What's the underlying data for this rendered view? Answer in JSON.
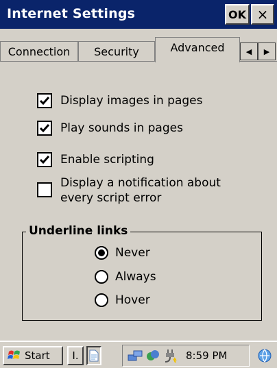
{
  "window": {
    "title": "Internet Settings",
    "ok_label": "OK",
    "close_label": "×"
  },
  "tabs": [
    {
      "label": "Connection"
    },
    {
      "label": "Security"
    },
    {
      "label": "Advanced",
      "selected": true
    }
  ],
  "tab_scroll": {
    "prev_glyph": "◀",
    "next_glyph": "▶"
  },
  "options": [
    {
      "label": "Display images in pages",
      "checked": true
    },
    {
      "label": "Play sounds in pages",
      "checked": true
    },
    {
      "label": "Enable scripting",
      "checked": true
    },
    {
      "label": "Display a notification about every script error",
      "checked": false
    }
  ],
  "underline_links": {
    "title": "Underline links",
    "options": [
      {
        "label": "Never",
        "selected": true
      },
      {
        "label": "Always",
        "selected": false
      },
      {
        "label": "Hover",
        "selected": false
      }
    ]
  },
  "taskbar": {
    "start_label": "Start",
    "task_label": "I.",
    "time": "8:59 PM"
  },
  "icons": {
    "flag": "windows-flag-icon",
    "doc": "document-icon",
    "network": "network-icon",
    "sync": "sync-icon",
    "power": "power-plug-icon",
    "globe": "internet-explorer-icon"
  },
  "colors": {
    "titlebar": "#0a246a",
    "surface": "#d4d0c8"
  }
}
